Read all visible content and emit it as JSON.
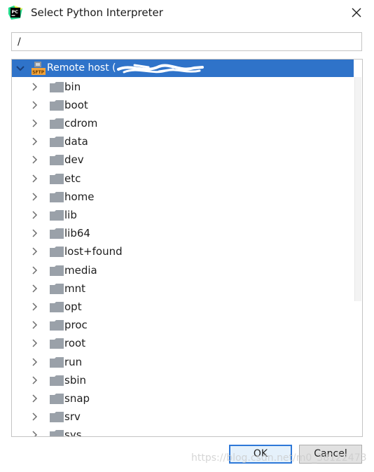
{
  "window": {
    "title": "Select Python Interpreter",
    "app_icon": "pycharm-icon",
    "app_icon_text": "PC",
    "close_icon": "close-icon"
  },
  "path_input": {
    "value": "/"
  },
  "tree": {
    "root": {
      "label": "Remote host (",
      "icon": "sftp-icon",
      "icon_text": "SFTP",
      "expanded": true
    },
    "items": [
      {
        "label": "bin"
      },
      {
        "label": "boot"
      },
      {
        "label": "cdrom"
      },
      {
        "label": "data"
      },
      {
        "label": "dev"
      },
      {
        "label": "etc"
      },
      {
        "label": "home"
      },
      {
        "label": "lib"
      },
      {
        "label": "lib64"
      },
      {
        "label": "lost+found"
      },
      {
        "label": "media"
      },
      {
        "label": "mnt"
      },
      {
        "label": "opt"
      },
      {
        "label": "proc"
      },
      {
        "label": "root"
      },
      {
        "label": "run"
      },
      {
        "label": "sbin"
      },
      {
        "label": "snap"
      },
      {
        "label": "srv"
      },
      {
        "label": "sys"
      }
    ],
    "selected_color": "#2f73c9",
    "folder_color": "#9aa1a9"
  },
  "buttons": {
    "ok": "OK",
    "cancel": "Cancel"
  },
  "watermark": "https://blog.csdn.net/m0_38122473"
}
